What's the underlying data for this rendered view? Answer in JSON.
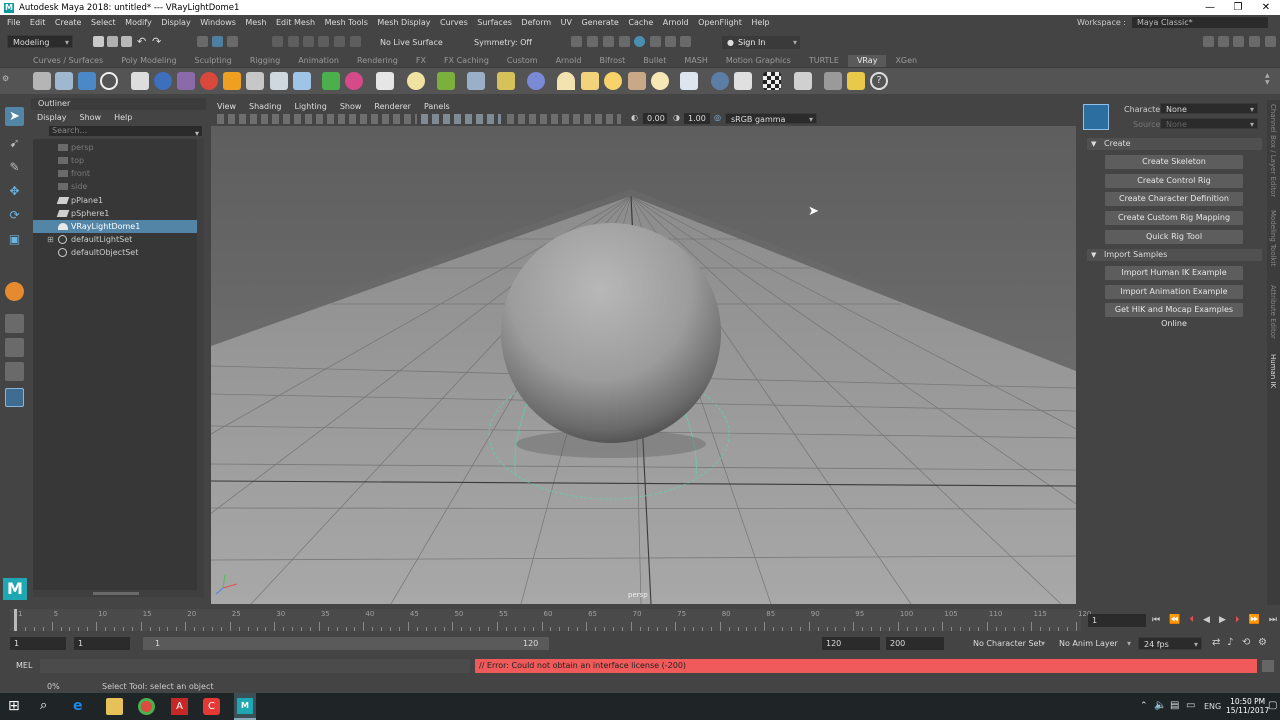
{
  "window": {
    "title": "Autodesk Maya 2018: untitled*  ---  VRayLightDome1",
    "controls": [
      "—",
      "❐",
      "✕"
    ]
  },
  "menubar": {
    "items": [
      "File",
      "Edit",
      "Create",
      "Select",
      "Modify",
      "Display",
      "Windows",
      "Mesh",
      "Edit Mesh",
      "Mesh Tools",
      "Mesh Display",
      "Curves",
      "Surfaces",
      "Deform",
      "UV",
      "Generate",
      "Cache",
      "Arnold",
      "OpenFlight",
      "Help"
    ],
    "workspace_label": "Workspace :",
    "workspace_value": "Maya Classic*"
  },
  "statusline": {
    "mode": "Modeling",
    "live_surface": "No Live Surface",
    "symmetry": "Symmetry: Off",
    "sign_in": "Sign In"
  },
  "shelf": {
    "tabs": [
      "Curves / Surfaces",
      "Poly Modeling",
      "Sculpting",
      "Rigging",
      "Animation",
      "Rendering",
      "FX",
      "FX Caching",
      "Custom",
      "Arnold",
      "Bifrost",
      "Bullet",
      "MASH",
      "Motion Graphics",
      "TURTLE",
      "VRay",
      "XGen"
    ],
    "active_tab": "VRay"
  },
  "outliner": {
    "title": "Outliner",
    "menu": [
      "Display",
      "Show",
      "Help"
    ],
    "search_placeholder": "Search...",
    "items": [
      {
        "label": "persp",
        "state": "dim"
      },
      {
        "label": "top",
        "state": "dim"
      },
      {
        "label": "front",
        "state": "dim"
      },
      {
        "label": "side",
        "state": "dim"
      },
      {
        "label": "pPlane1",
        "state": "normal"
      },
      {
        "label": "pSphere1",
        "state": "normal"
      },
      {
        "label": "VRayLightDome1",
        "state": "selected"
      },
      {
        "label": "defaultLightSet",
        "state": "normal"
      },
      {
        "label": "defaultObjectSet",
        "state": "normal"
      }
    ]
  },
  "viewport": {
    "menu": [
      "View",
      "Shading",
      "Lighting",
      "Show",
      "Renderer",
      "Panels"
    ],
    "exposure": "0.00",
    "gamma": "1.00",
    "color_space": "sRGB gamma",
    "camera_label": "persp"
  },
  "hik": {
    "character_label": "Character:",
    "character_value": "None",
    "source_label": "Source:",
    "source_value": "None",
    "create_section": "Create",
    "create_buttons": [
      "Create Skeleton",
      "Create Control Rig",
      "Create Character Definition",
      "Create Custom Rig Mapping",
      "Quick Rig Tool"
    ],
    "import_section": "Import Samples",
    "import_buttons": [
      "Import Human IK Example",
      "Import Animation Example",
      "Get HIK and Mocap Examples Online"
    ]
  },
  "side_tabs": [
    "Channel Box / Layer Editor",
    "Modeling Toolkit",
    "Attribute Editor",
    "Human IK"
  ],
  "timeslider": {
    "ticks": [
      "1",
      "5",
      "10",
      "15",
      "20",
      "25",
      "30",
      "35",
      "40",
      "45",
      "50",
      "55",
      "60",
      "65",
      "70",
      "75",
      "80",
      "85",
      "90",
      "95",
      "100",
      "105",
      "110",
      "115",
      "120"
    ],
    "current_frame": "1"
  },
  "rangeslider": {
    "start": "1",
    "inner_start": "1",
    "handle_start": "1",
    "handle_end": "120",
    "end": "120",
    "max": "200",
    "character_set": "No Character Set",
    "anim_layer": "No Anim Layer",
    "fps": "24 fps"
  },
  "cmdline": {
    "mode": "MEL",
    "error": "// Error: Could not obtain an interface license (-200)"
  },
  "helpline": {
    "progress": "0%",
    "text": "Select Tool: select an object"
  },
  "taskbar": {
    "language": "ENG",
    "time": "10:50 PM",
    "date": "15/11/2017"
  },
  "colors": {
    "accent_selected": "#5285a6",
    "error_bg": "#f05a5a",
    "vray_tab": "#5a5a5a"
  }
}
